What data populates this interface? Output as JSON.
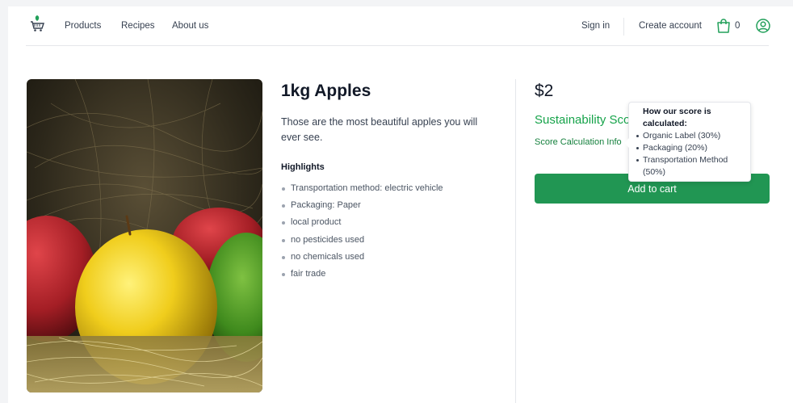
{
  "header": {
    "logo_icon": "shopping-cart-leaf-icon",
    "nav": [
      "Products",
      "Recipes",
      "About us"
    ],
    "sign_in": "Sign in",
    "create_account": "Create account",
    "cart_icon": "shopping-bag-icon",
    "cart_count": "0",
    "user_icon": "user-circle-icon"
  },
  "product": {
    "image_alt": "Apples on straw",
    "title": "1kg Apples",
    "description": "Those are the most beautiful apples you will ever see.",
    "highlights_title": "Highlights",
    "highlights": [
      "Transportation method: electric vehicle",
      "Packaging: Paper",
      "local product",
      "no pesticides used",
      "no chemicals used",
      "fair trade"
    ],
    "price": "$2",
    "sustainability_label": "Sustainability Score",
    "score_info_link": "Score Calculation Info",
    "add_to_cart": "Add to cart"
  },
  "tooltip": {
    "title": "How our score is calculated:",
    "items": [
      "Organic Label (30%)",
      "Packaging (20%)",
      "Transportation Method (50%)"
    ]
  },
  "colors": {
    "brand_green": "#219653",
    "text_green": "#16a34a",
    "apple_yellow": "#e9c419",
    "apple_red": "#b3262b"
  }
}
